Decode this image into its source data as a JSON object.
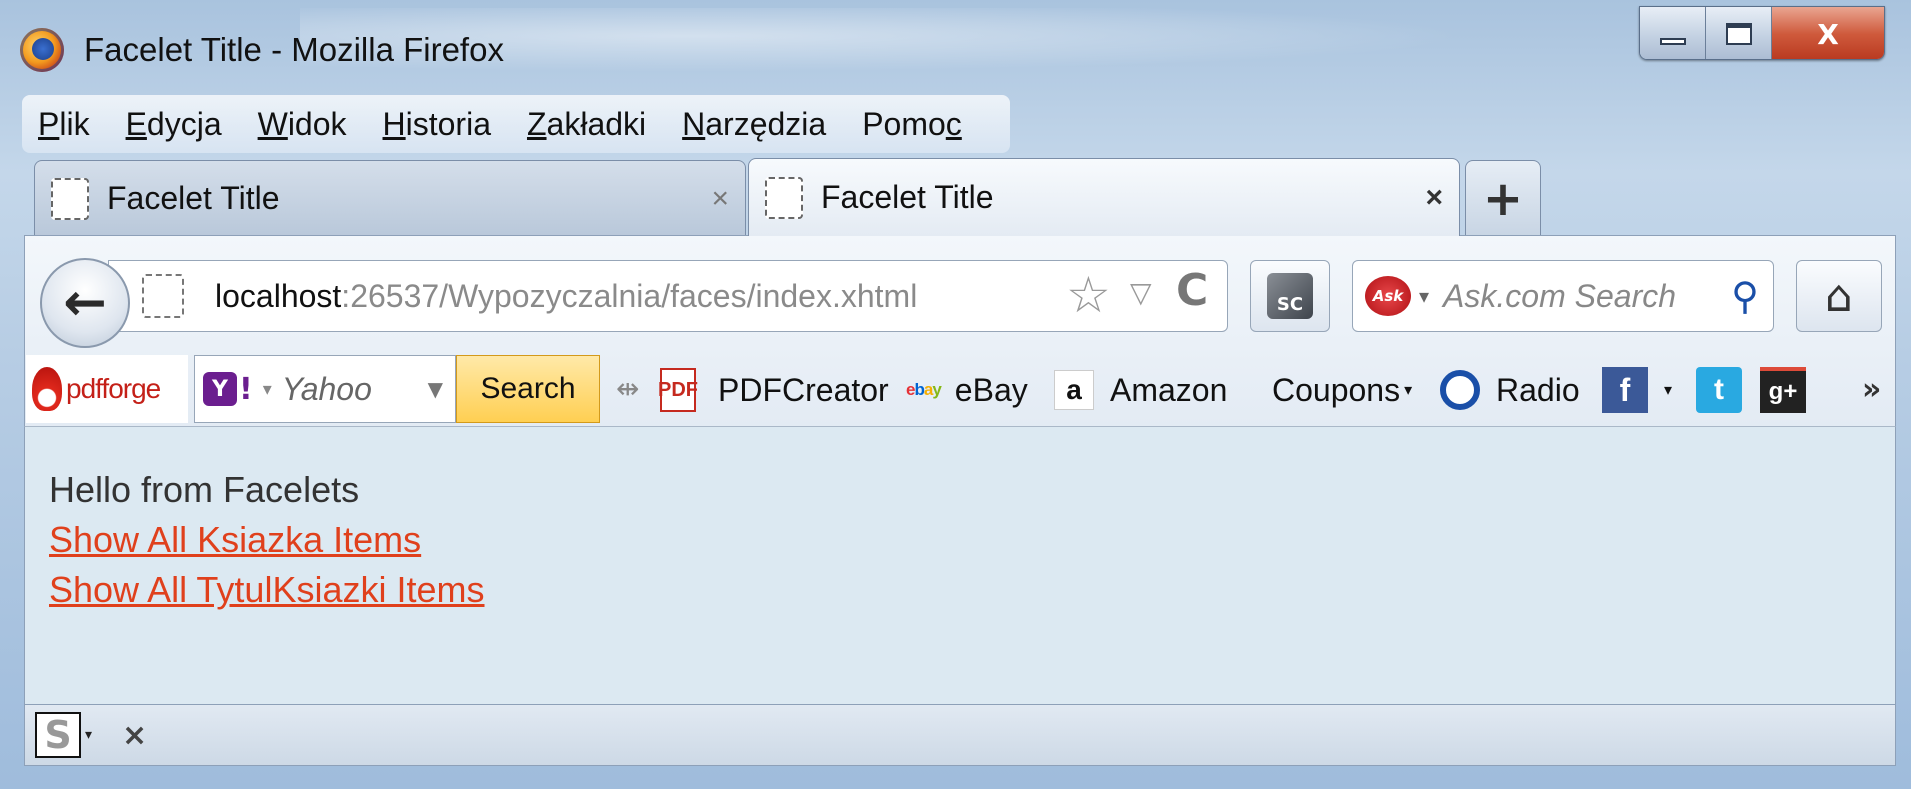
{
  "window": {
    "title": "Facelet Title - Mozilla Firefox",
    "controls": {
      "minimize": "minimize",
      "maximize": "maximize",
      "close_glyph": "X"
    }
  },
  "menubar": {
    "items": [
      {
        "label": "Plik",
        "accesskey": "P"
      },
      {
        "label": "Edycja",
        "accesskey": "E"
      },
      {
        "label": "Widok",
        "accesskey": "W"
      },
      {
        "label": "Historia",
        "accesskey": "H"
      },
      {
        "label": "Zakładki",
        "accesskey": "Z"
      },
      {
        "label": "Narzędzia",
        "accesskey": "N"
      },
      {
        "label": "Pomoc",
        "accesskey": "c"
      }
    ]
  },
  "tabs": [
    {
      "label": "Facelet Title",
      "active": false,
      "close": "×"
    },
    {
      "label": "Facelet Title",
      "active": true,
      "close": "×"
    }
  ],
  "new_tab_label": "+",
  "navbar": {
    "back_icon": "←",
    "url_host": "localhost",
    "url_rest": ":26537/Wypozyczalnia/faces/index.xhtml",
    "star_icon": "☆",
    "dropdown_icon": "▽",
    "reload_icon": "C",
    "sc_icon_label": "SC",
    "search": {
      "engine_logo": "Ask",
      "placeholder": "Ask.com Search",
      "go_icon": "⚲"
    },
    "home_icon": "⌂"
  },
  "toolbar": {
    "pdfforge_label": "pdfforge",
    "yahoo": {
      "logo": "Y",
      "bang": "!",
      "placeholder": "Yahoo",
      "search_button": "Search"
    },
    "grip": "⇹",
    "bookmarks": {
      "pdfcreator": {
        "label": "PDFCreator",
        "icon": "PDF"
      },
      "ebay": {
        "label": "eBay",
        "icon": "ebay"
      },
      "amazon": {
        "label": "Amazon",
        "icon": "a"
      },
      "coupons": {
        "label": "Coupons",
        "caret": "▾"
      },
      "radio": {
        "label": "Radio"
      },
      "facebook": {
        "icon": "f",
        "caret": "▾"
      },
      "twitter": {
        "icon": "t"
      },
      "googleplus": {
        "icon": "g+"
      }
    },
    "overflow": "»"
  },
  "content": {
    "hello": "Hello from Facelets",
    "links": [
      "Show All Ksiazka Items",
      "Show All TytulKsiazki Items"
    ]
  },
  "addonbar": {
    "s_icon": "S",
    "caret": "▾",
    "close": "×"
  },
  "colors": {
    "link": "#e0401c",
    "content_bg": "#dce9f2",
    "close_button": "#cf5a3c",
    "search_button": "#ffcf52"
  }
}
